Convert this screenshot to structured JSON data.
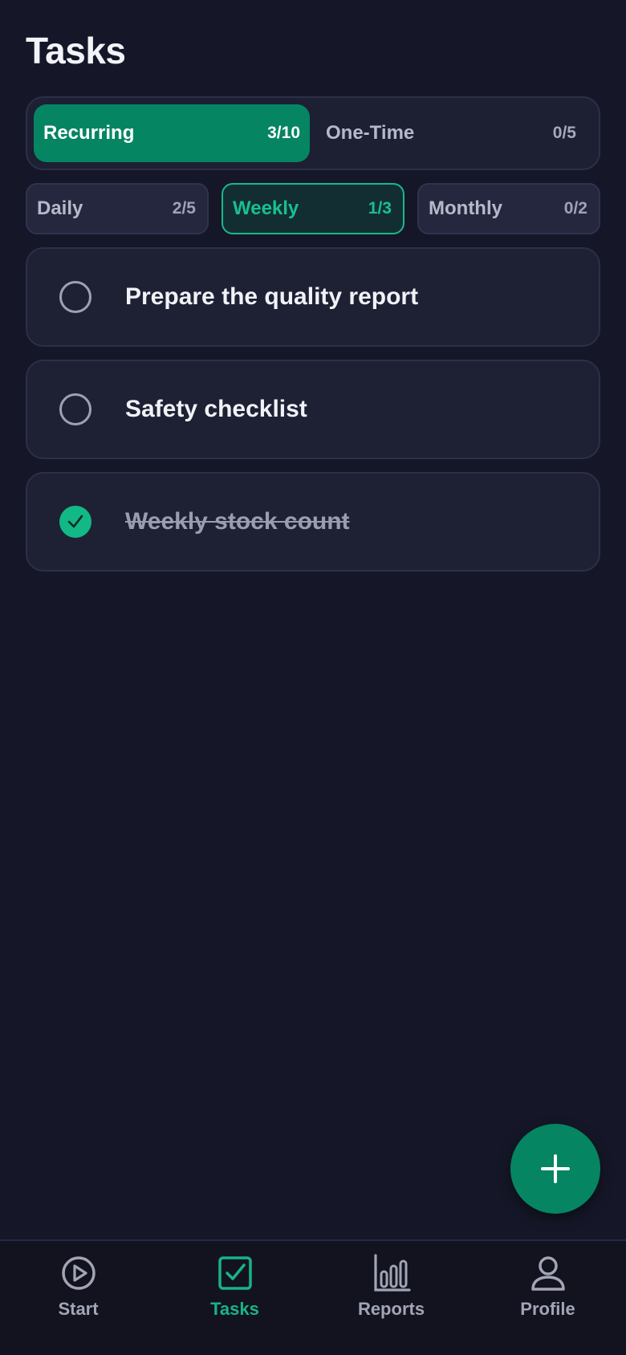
{
  "header": {
    "title": "Tasks"
  },
  "segment": {
    "items": [
      {
        "label": "Recurring",
        "count": "3/10",
        "active": true
      },
      {
        "label": "One-Time",
        "count": "0/5",
        "active": false
      }
    ]
  },
  "subtabs": {
    "items": [
      {
        "label": "Daily",
        "count": "2/5"
      },
      {
        "label": "Weekly",
        "count": "1/3"
      },
      {
        "label": "Monthly",
        "count": "0/2"
      }
    ]
  },
  "tasks": [
    {
      "label": "Prepare the quality report",
      "done": false
    },
    {
      "label": "Safety checklist",
      "done": false
    },
    {
      "label": "Weekly stock count",
      "done": true
    }
  ],
  "fab": {
    "icon": "plus-icon"
  },
  "bottom_nav": {
    "items": [
      {
        "label": "Start",
        "icon": "play-circle-icon"
      },
      {
        "label": "Tasks",
        "icon": "checkbox-icon"
      },
      {
        "label": "Reports",
        "icon": "bar-chart-icon"
      },
      {
        "label": "Profile",
        "icon": "user-icon"
      }
    ]
  },
  "colors": {
    "background": "#151728",
    "accent": "#058562",
    "accent_text": "#18c08f",
    "card": "#1e2034"
  }
}
